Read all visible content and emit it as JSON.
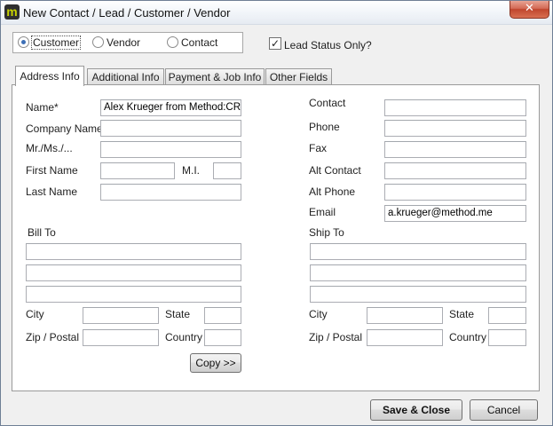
{
  "window": {
    "title": "New Contact / Lead / Customer / Vendor",
    "app_icon_glyph": "m",
    "close_glyph": "✕"
  },
  "record_type": {
    "options": [
      "Customer",
      "Vendor",
      "Contact"
    ],
    "selected": "Customer",
    "lead_status_label": "Lead Status Only?",
    "lead_status_checked": true
  },
  "tabs": [
    "Address Info",
    "Additional Info",
    "Payment & Job Info",
    "Other Fields"
  ],
  "active_tab": "Address Info",
  "left_form": {
    "name_label": "Name*",
    "name_value": "Alex Krueger from Method:CRM",
    "company_label": "Company Name",
    "company_value": "",
    "salutation_label": "Mr./Ms./...",
    "salutation_value": "",
    "first_name_label": "First Name",
    "first_name_value": "",
    "mi_label": "M.I.",
    "mi_value": "",
    "last_name_label": "Last Name",
    "last_name_value": ""
  },
  "right_form": {
    "contact_label": "Contact",
    "contact_value": "",
    "phone_label": "Phone",
    "phone_value": "",
    "fax_label": "Fax",
    "fax_value": "",
    "alt_contact_label": "Alt Contact",
    "alt_contact_value": "",
    "alt_phone_label": "Alt Phone",
    "alt_phone_value": "",
    "email_label": "Email",
    "email_value": "a.krueger@method.me"
  },
  "bill_to": {
    "heading": "Bill To",
    "line1": "",
    "line2": "",
    "line3": "",
    "city_label": "City",
    "city": "",
    "state_label": "State",
    "state": "",
    "zip_label": "Zip / Postal",
    "zip": "",
    "country_label": "Country",
    "country": ""
  },
  "ship_to": {
    "heading": "Ship To",
    "line1": "",
    "line2": "",
    "line3": "",
    "city_label": "City",
    "city": "",
    "state_label": "State",
    "state": "",
    "zip_label": "Zip / Postal",
    "zip": "",
    "country_label": "Country",
    "country": ""
  },
  "buttons": {
    "copy": "Copy >>",
    "save_close": "Save & Close",
    "cancel": "Cancel"
  },
  "colors": {
    "title_bar": "#e6ebf2",
    "close_button": "#c0462d",
    "radio_selected": "#3d6fb6",
    "app_icon_bg": "#2f2f2f",
    "app_icon_fg": "#c7d200"
  }
}
